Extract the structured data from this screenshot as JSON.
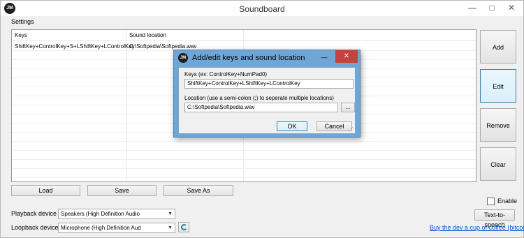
{
  "window": {
    "title": "Soundboard",
    "logo": "JM",
    "minimize_icon": "minimize-icon",
    "maximize_icon": "maximize-icon",
    "close_icon": "close-icon"
  },
  "menu": {
    "items": [
      "Settings"
    ]
  },
  "list": {
    "columns": [
      "Keys",
      "Sound location"
    ],
    "rows": [
      {
        "keys": "ShiftKey+ControlKey+S+LShiftKey+LControlKey",
        "location": "C:\\Softpedia\\Softpedia.wav"
      }
    ]
  },
  "side_buttons": {
    "add": "Add",
    "edit": "Edit",
    "remove": "Remove",
    "clear": "Clear"
  },
  "bottom_buttons": {
    "load": "Load",
    "save": "Save",
    "save_as": "Save As"
  },
  "enable": {
    "label": "Enable",
    "checked": false
  },
  "playback": {
    "label": "Playback device",
    "value": "Speakers (High Definition Audio"
  },
  "loopback": {
    "label": "Loopback device",
    "value": "Microphone (High Definition Aud"
  },
  "tts_button": "Text-to-speech",
  "coffee_link": "Buy the dev a cup of coffee (bitcoin)",
  "dialog": {
    "title": "Add/edit keys and sound location",
    "logo": "JM",
    "keys_label": "Keys (ex: ControlKey+NumPad0)",
    "keys_value": "ShiftKey+ControlKey+LShiftKey+LControlKey",
    "location_label": "Location (use a semi-colon (;) to seperate multiple locations)",
    "location_value": "C:\\Softpedia\\Softpedia.wav",
    "browse_label": "...",
    "ok_label": "OK",
    "cancel_label": "Cancel"
  },
  "colors": {
    "dialog_frame": "#6ea6d6",
    "close_red": "#c7423b",
    "link_blue": "#0a54c9",
    "focus_border": "#3c7fb1"
  }
}
